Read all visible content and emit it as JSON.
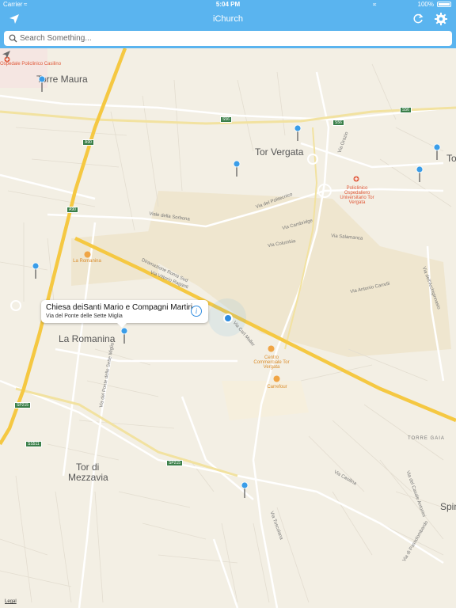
{
  "status_bar": {
    "carrier": "Carrier",
    "time": "5:04 PM",
    "battery": "100%"
  },
  "nav": {
    "title": "iChurch"
  },
  "search": {
    "placeholder": "Search Something..."
  },
  "map": {
    "place_labels": [
      "Torre Maura",
      "Tor Vergata",
      "To",
      "La Romanina",
      "Tor di",
      "Mezzavia",
      "Spin",
      "TORRE GAIA"
    ],
    "poi_labels": [
      "Ospedale Policlinico Casilino",
      "Policlinico Ospedaliero Universitario Tor Vergata",
      "La Romanina",
      "Centro Commerciale Tor Vergata",
      "Carrefour"
    ],
    "shields": [
      "A90",
      "A90",
      "S56",
      "S56",
      "S56",
      "SP215",
      "SS511",
      "SP215"
    ],
    "street_labels": [
      "Viale della Sorbona",
      "Via del Politecnico",
      "Via Cambridge",
      "Via Columbia",
      "Via Salamanca",
      "Via Antonio Carrelli",
      "Via Orazio",
      "Diramazione Roma Sud",
      "Via Vittorio Raganti",
      "Via dell'Archiginnasio",
      "Via Carl Moller",
      "Via del Ponte delle Sette Miglia",
      "Via Casilina",
      "Via di Passolombardo",
      "Via del Casale Antonini",
      "Via Tuscolana"
    ],
    "legal": "Legal"
  },
  "callout": {
    "title": "Chiesa deiSanti Mario e Compagni Martiri",
    "subtitle": "Via del Ponte delle Sette Miglia",
    "info_icon": "i"
  },
  "colors": {
    "bar": "#5ab4ef",
    "highway": "#f5c842",
    "map_bg": "#f3efe4",
    "pin": "#3a9de8"
  }
}
